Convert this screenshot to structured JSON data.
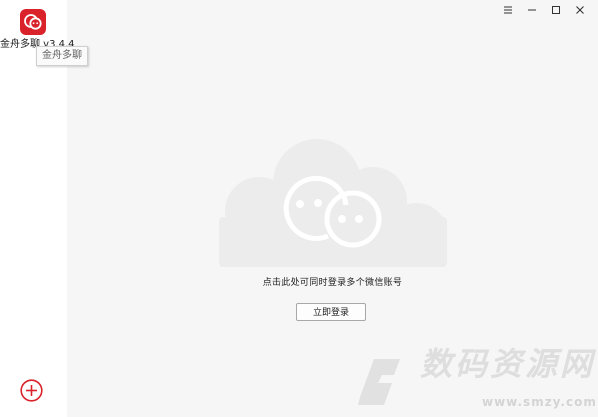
{
  "app": {
    "version_label": "金舟多聊 v3.4.4",
    "tooltip": "金舟多聊",
    "brand_color": "#d9222a",
    "logo_icon": "chat-bubbles-icon"
  },
  "window_controls": [
    {
      "name": "menu-button",
      "glyph": "≡"
    },
    {
      "name": "minimize-button",
      "glyph": "–"
    },
    {
      "name": "maximize-button",
      "glyph": "☐"
    },
    {
      "name": "close-button",
      "glyph": "✕"
    }
  ],
  "main": {
    "prompt": "点击此处可同时登录多个微信账号",
    "login_button": "立即登录"
  },
  "sidebar": {
    "add_icon": "plus-circle-icon",
    "add_color": "#d9222a"
  },
  "watermark": {
    "title": "数码资源网",
    "url": "www.smzy.com"
  }
}
